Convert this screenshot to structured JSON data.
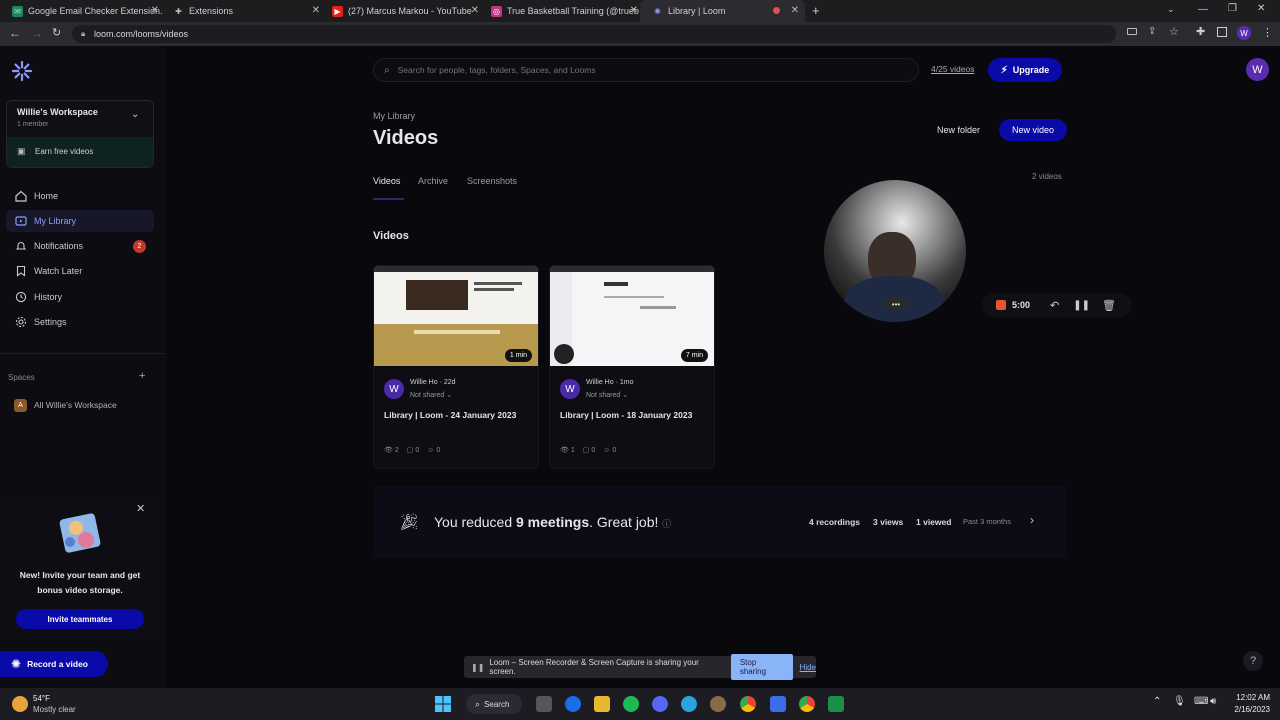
{
  "browser": {
    "tabs": [
      {
        "title": "Google Email Checker Extension.",
        "icon": "gmail-checker-icon",
        "color": "#1a8a5a"
      },
      {
        "title": "Extensions",
        "icon": "puzzle-icon",
        "color": "#888888"
      },
      {
        "title": "(27) Marcus Markou - YouTube",
        "icon": "youtube-icon",
        "color": "#e62117"
      },
      {
        "title": "True Basketball Training (@trueb",
        "icon": "instagram-icon",
        "color": "#c13584"
      },
      {
        "title": "Library | Loom",
        "icon": "loom-icon",
        "color": "#625df5"
      }
    ],
    "new_tab": "+",
    "url": "loom.com/looms/videos"
  },
  "sidebar": {
    "workspace_name": "Willie's Workspace",
    "workspace_members": "1 member",
    "earn_free": "Earn free videos",
    "nav": [
      {
        "label": "Home",
        "icon": "home-icon"
      },
      {
        "label": "My Library",
        "icon": "library-icon"
      },
      {
        "label": "Notifications",
        "icon": "bell-icon",
        "badge": "2"
      },
      {
        "label": "Watch Later",
        "icon": "bookmark-icon"
      },
      {
        "label": "History",
        "icon": "clock-icon"
      },
      {
        "label": "Settings",
        "icon": "gear-icon"
      }
    ],
    "spaces_label": "Spaces",
    "spaces_add": "+",
    "space_item": "All Willie's Workspace",
    "space_letter": "A",
    "invite_title": "New! Invite your team and get bonus video storage.",
    "invite_button": "Invite teammates",
    "record_button": "Record a video"
  },
  "header": {
    "search_placeholder": "Search for people, tags, folders, Spaces, and Looms",
    "video_count": "4/25 videos",
    "upgrade": "Upgrade",
    "user_initial": "W"
  },
  "main": {
    "breadcrumb": "My Library",
    "title": "Videos",
    "new_folder": "New folder",
    "new_video": "New video",
    "tabs": [
      "Videos",
      "Archive",
      "Screenshots"
    ],
    "total_videos": "2 videos",
    "section_title": "Videos",
    "videos": [
      {
        "author": "Willie Ho",
        "age": "22d",
        "share": "Not shared",
        "title": "Library | Loom - 24 January 2023",
        "duration": "1 min",
        "views": "2",
        "comments": "0",
        "reactions": "0"
      },
      {
        "author": "Willie Ho",
        "age": "1mo",
        "share": "Not shared",
        "title": "Library | Loom - 18 January 2023",
        "duration": "7 min",
        "views": "1",
        "comments": "0",
        "reactions": "0"
      }
    ],
    "banner": {
      "prefix": "You reduced ",
      "highlight": "9 meetings",
      "suffix": ". Great job!",
      "recordings": "4 recordings",
      "views": "3 views",
      "viewed": "1 viewed",
      "period": "Past 3 months"
    }
  },
  "recorder": {
    "timer": "5:00"
  },
  "share_bar": {
    "message": "Loom – Screen Recorder & Screen Capture is sharing your screen.",
    "stop": "Stop sharing",
    "hide": "Hide"
  },
  "help": "?",
  "taskbar": {
    "weather_temp": "54°F",
    "weather_desc": "Mostly clear",
    "search": "Search",
    "time": "12:02 AM",
    "date": "2/16/2023"
  },
  "colors": {
    "accent": "#625df5",
    "primary_button": "#0a0aa8"
  }
}
